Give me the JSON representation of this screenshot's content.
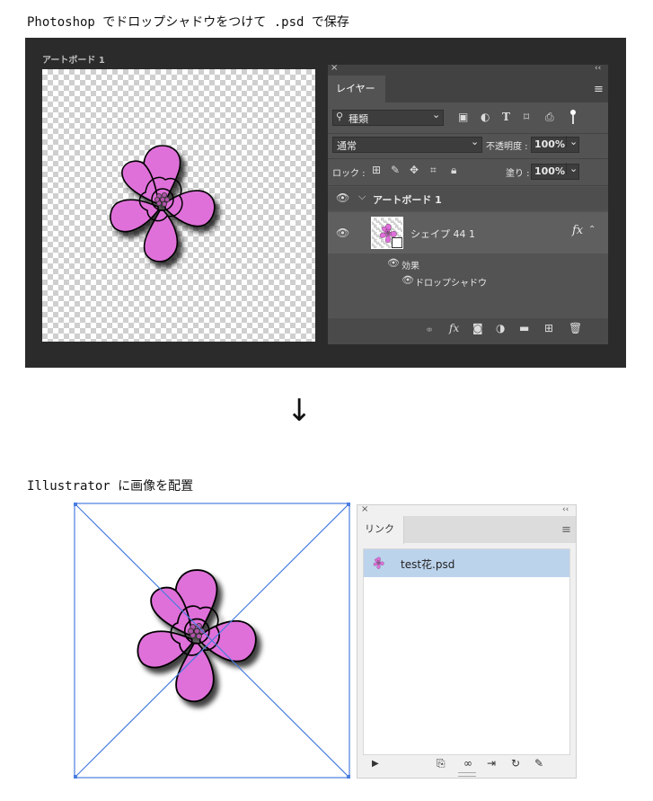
{
  "captions": {
    "top": "Photoshop でドロップシャドウをつけて .psd で保存",
    "middle": "Illustrator に画像を配置"
  },
  "arrow": "↓",
  "photoshop": {
    "artboard_label": "アートボード 1",
    "layers_panel": {
      "close_glyph": "×",
      "collapse_glyph": "‹‹",
      "tab": "レイヤー",
      "menu_glyph": "≡",
      "filter": {
        "value": "種類",
        "chevron": "⌄"
      },
      "filter_icons": [
        "image-filter-icon",
        "adjustment-filter-icon",
        "type-filter-icon",
        "shape-filter-icon",
        "smart-object-filter-icon",
        "toggle-filter-icon"
      ],
      "blend_mode": "通常",
      "opacity_label": "不透明度 :",
      "opacity_value": "100%",
      "lock_label": "ロック :",
      "fill_label": "塗り :",
      "fill_value": "100%",
      "layers": [
        {
          "name": "アートボード 1",
          "type": "artboard"
        },
        {
          "name": "シェイプ 44 1",
          "type": "shape",
          "fx": "fx"
        }
      ],
      "effects_label": "効果",
      "effect_item": "ドロップシャドウ",
      "bottom_icons": [
        "link-icon",
        "fx-icon",
        "mask-icon",
        "adjustment-icon",
        "folder-icon",
        "new-layer-icon",
        "trash-icon"
      ]
    }
  },
  "illustrator": {
    "links_panel": {
      "close_glyph": "×",
      "collapse_glyph": "‹‹",
      "tab": "リンク",
      "menu_glyph": "≡",
      "items": [
        {
          "name": "test花.psd"
        }
      ],
      "footer_icons": [
        "show-info-icon",
        "relink-from-library-icon",
        "relink-icon",
        "go-to-link-icon",
        "update-link-icon",
        "edit-original-icon"
      ]
    }
  },
  "colors": {
    "flower_fill": "#df6fd9",
    "ps_background": "#2b2b2b",
    "ps_panel": "#535353",
    "ai_bounding_box": "#4a7de0",
    "link_selection": "#bcd3ec"
  }
}
